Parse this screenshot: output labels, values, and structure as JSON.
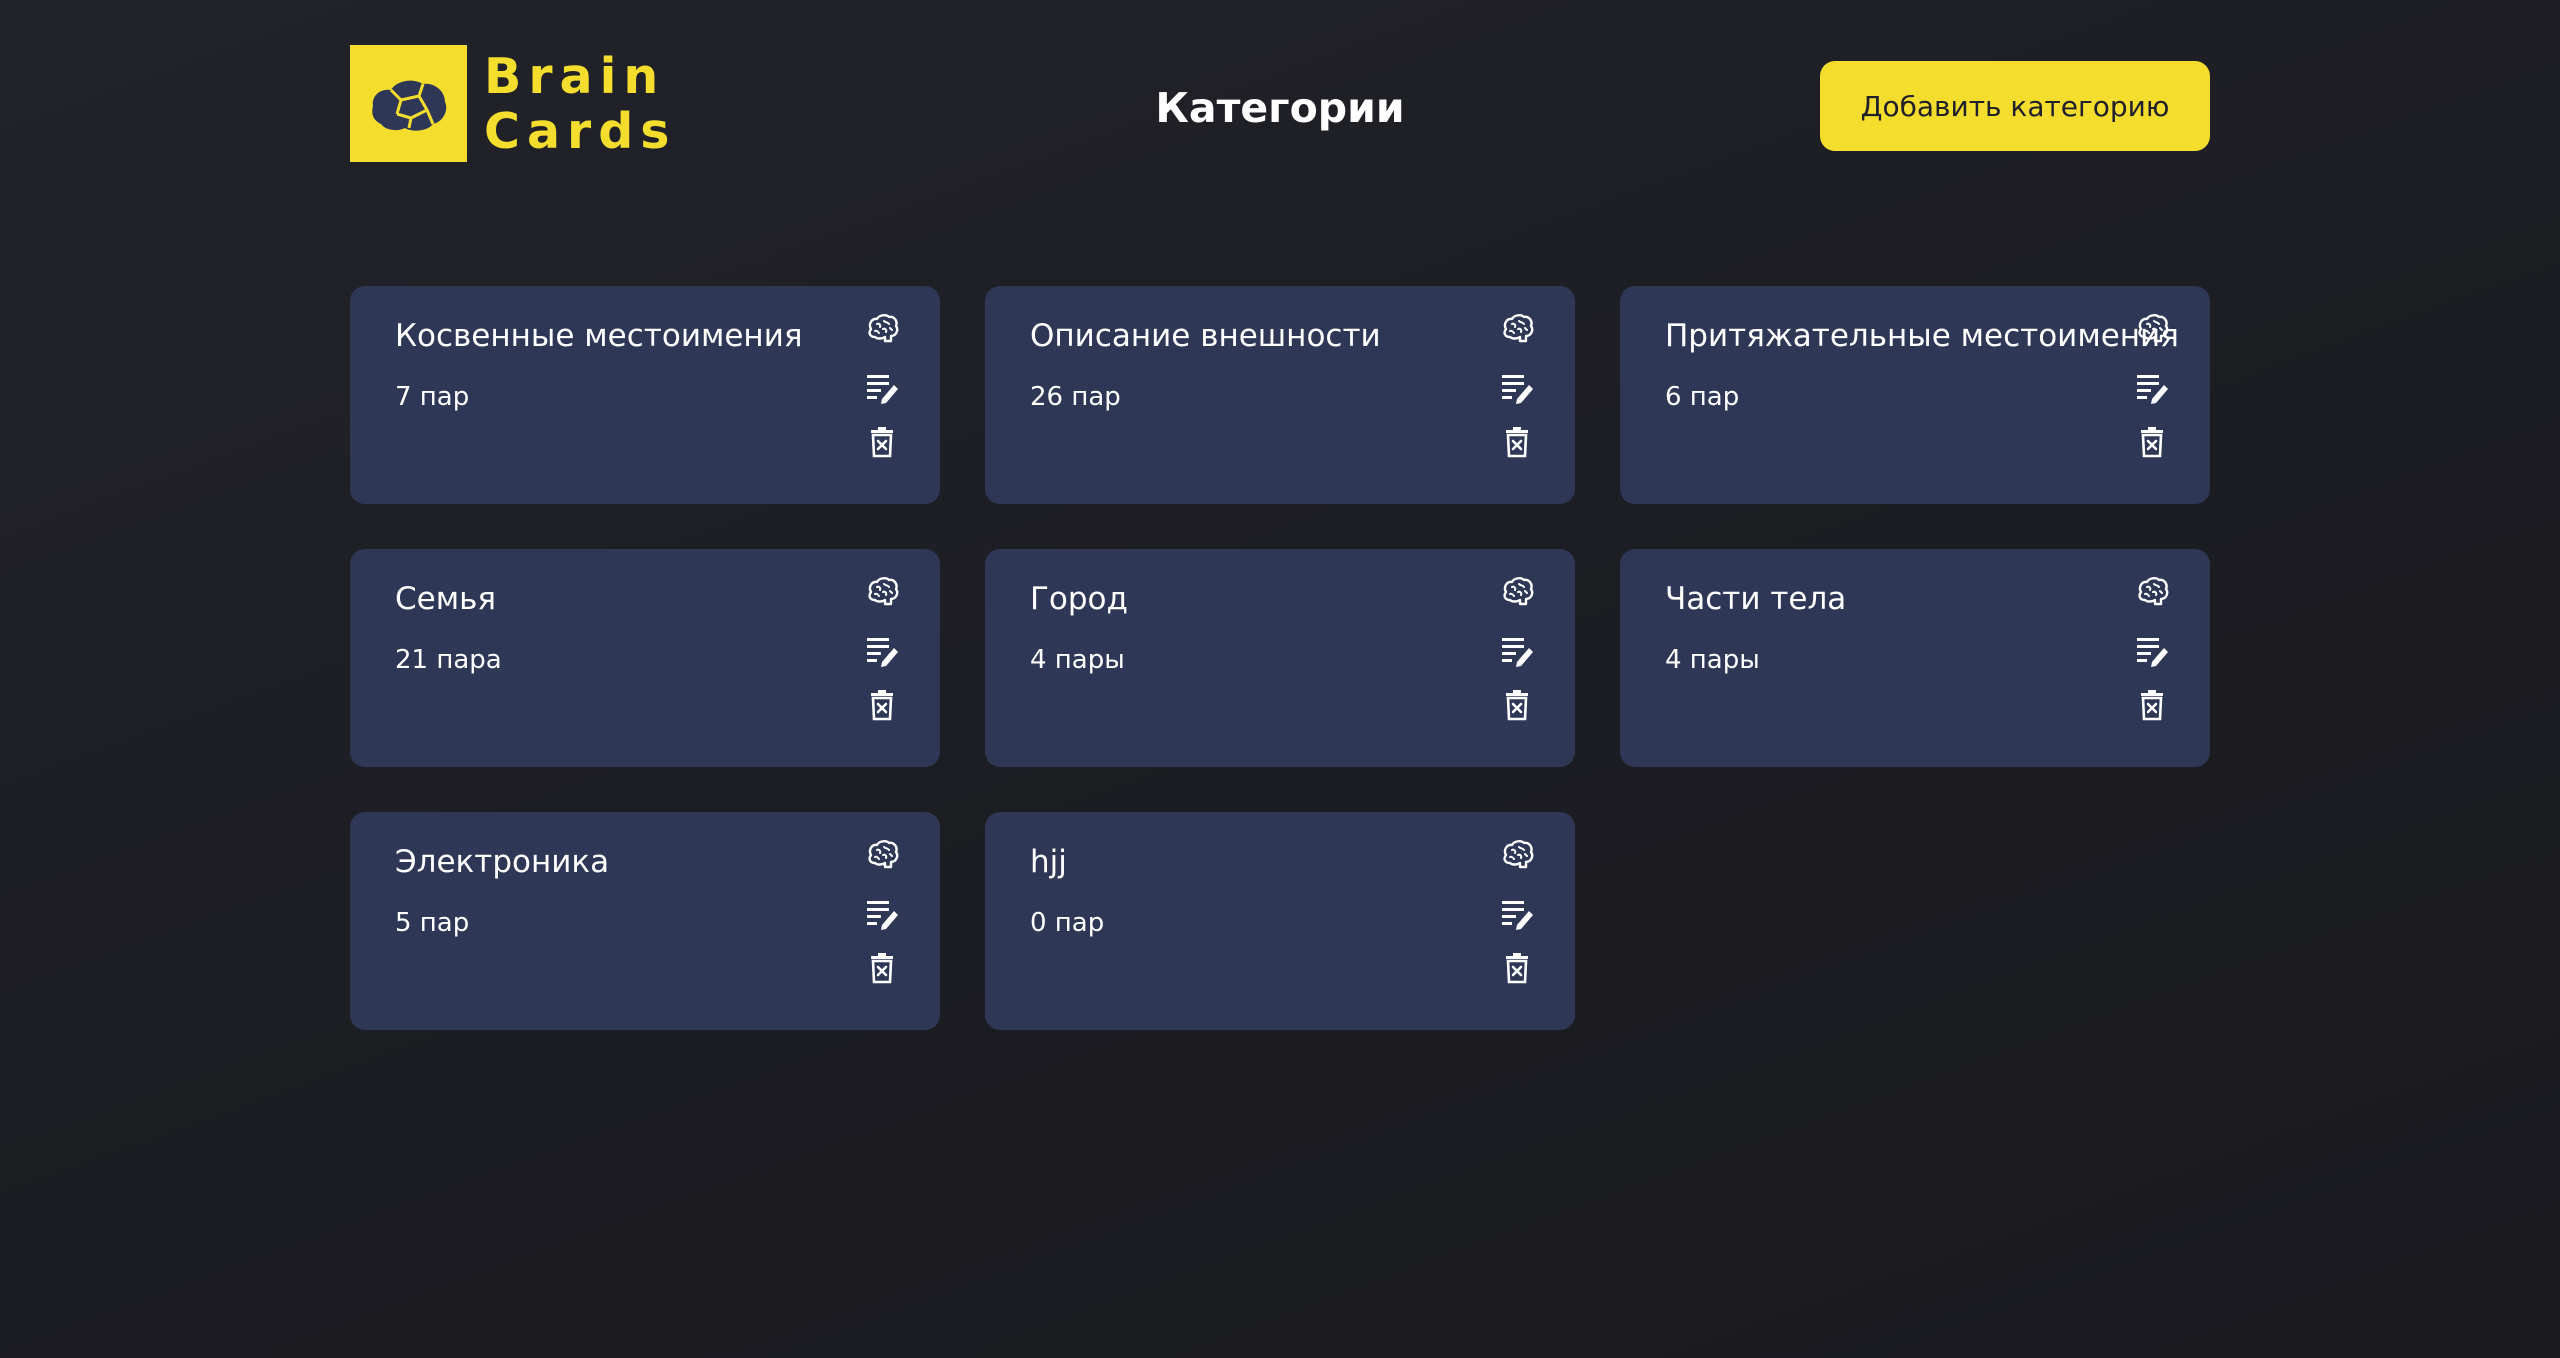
{
  "header": {
    "logo_line1": "Brain",
    "logo_line2": "Cards",
    "title": "Категории",
    "add_button_label": "Добавить категорию"
  },
  "colors": {
    "accent": "#f4dd2c",
    "card_bg": "#2e3756",
    "page_bg": "#1e1f25"
  },
  "icons": {
    "logo": "brain-icon",
    "study": "brain-icon",
    "edit": "edit-list-icon",
    "delete": "trash-icon"
  },
  "categories": [
    {
      "title": "Косвенные местоимения",
      "count": "7 пар"
    },
    {
      "title": "Описание внешности",
      "count": "26 пар"
    },
    {
      "title": "Притяжательные местоимения",
      "count": "6 пар"
    },
    {
      "title": "Семья",
      "count": "21 пара"
    },
    {
      "title": "Город",
      "count": "4 пары"
    },
    {
      "title": "Части тела",
      "count": "4 пары"
    },
    {
      "title": "Электроника",
      "count": "5 пар"
    },
    {
      "title": "hjj",
      "count": "0 пар"
    }
  ]
}
